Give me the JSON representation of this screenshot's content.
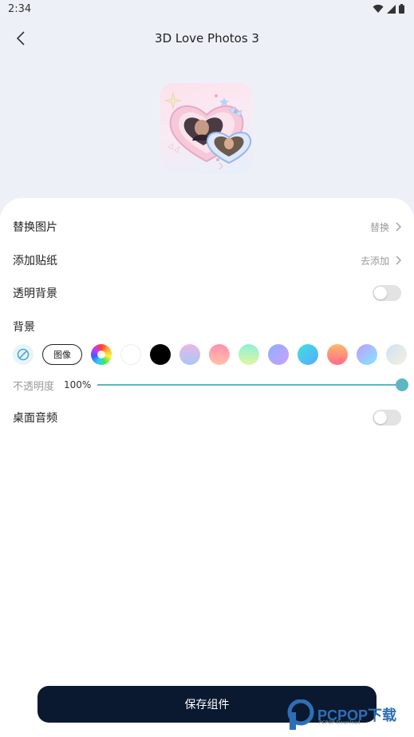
{
  "status_bar": {
    "time": "2:34"
  },
  "header": {
    "title": "3D Love Photos 3"
  },
  "rows": {
    "replace_image": {
      "label": "替换图片",
      "action": "替换"
    },
    "add_sticker": {
      "label": "添加贴纸",
      "action": "去添加"
    },
    "transparent_bg": {
      "label": "透明背景",
      "enabled": false
    },
    "background": {
      "label": "背景"
    },
    "desktop_audio": {
      "label": "桌面音频",
      "enabled": false
    }
  },
  "background_options": {
    "image_label": "图像",
    "swatch_colors": [
      "rainbow",
      "#ffffff",
      "#000000",
      "#c8b4f0→#a8c8f4",
      "#ff8fb1→#ffc3a8",
      "#a8f0c8→#d8f7a8",
      "#9ab8ff→#c8a0ff",
      "#4fd1e8→#5aa8ff",
      "#ffb07a→#ff6a8a",
      "#b89cff→#8fe0ff",
      "#cfe2f3"
    ]
  },
  "opacity": {
    "label": "不透明度",
    "value": "100%",
    "level": 1.0
  },
  "save_button": {
    "label": "保存组件"
  },
  "watermark": {
    "brand": "PCPOP下载",
    "sub": "PCPOP Download"
  },
  "colors": {
    "accent": "#5bb7c2",
    "primary_button": "#0b1930"
  }
}
